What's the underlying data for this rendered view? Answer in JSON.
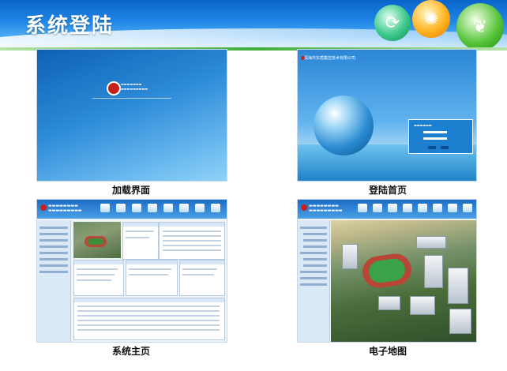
{
  "header": {
    "title": "系统登陆"
  },
  "panels": [
    {
      "id": "loading",
      "caption": "加载界面"
    },
    {
      "id": "login",
      "caption": "登陆首页"
    },
    {
      "id": "main",
      "caption": "系统主页"
    },
    {
      "id": "emap",
      "caption": "电子地图"
    }
  ],
  "login_screen": {
    "brand": "深海市东盾集控技术有限公司"
  },
  "colors": {
    "header_blue": "#1e86e6",
    "accent_green": "#3fae3a",
    "logo_red": "#c72020"
  }
}
